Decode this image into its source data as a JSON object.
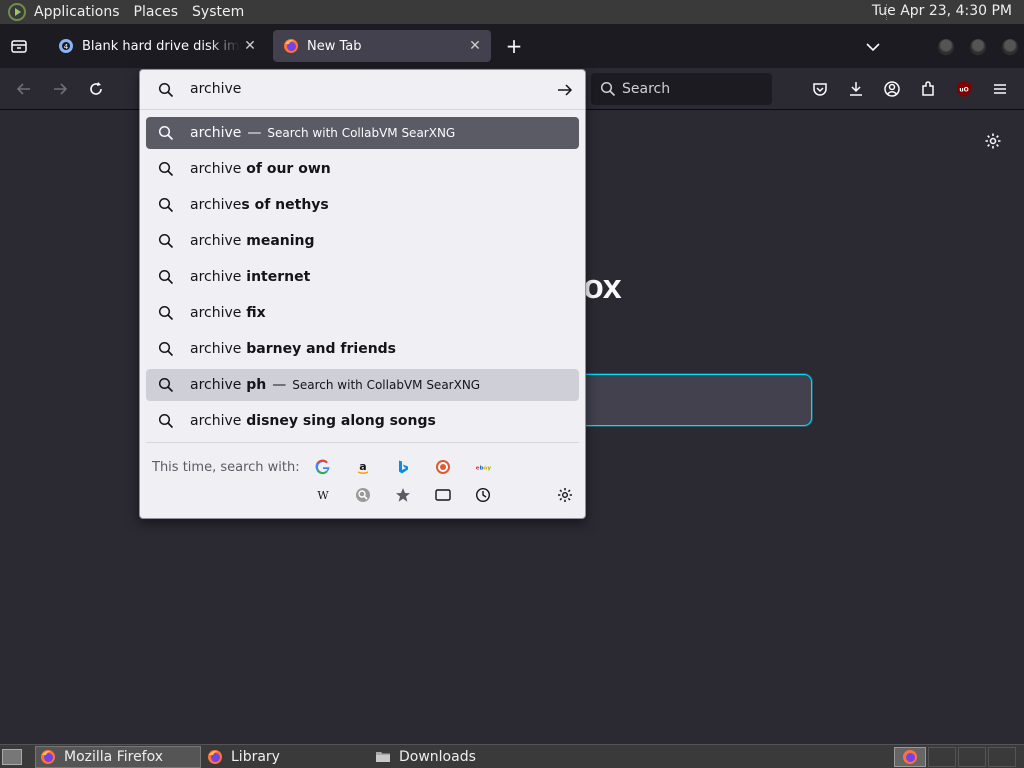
{
  "top_panel": {
    "menus": [
      "Applications",
      "Places",
      "System"
    ],
    "clock": "Tue Apr 23,  4:30 PM"
  },
  "tabs": [
    {
      "title": "Blank hard drive disk images",
      "close": "✕"
    },
    {
      "title": "New Tab",
      "close": "✕"
    }
  ],
  "tabbar": {
    "new_tab": "+"
  },
  "navbar": {
    "search_placeholder": "Search"
  },
  "urlbar": {
    "typed": "archive",
    "results": [
      {
        "prefix": "archive",
        "bold": "",
        "action": "Search with CollabVM SearXNG",
        "state": "selected"
      },
      {
        "prefix": "archive",
        "bold": " of our own",
        "action": "",
        "state": ""
      },
      {
        "prefix": "archive",
        "bold": "s of nethys",
        "action": "",
        "state": ""
      },
      {
        "prefix": "archive",
        "bold": " meaning",
        "action": "",
        "state": ""
      },
      {
        "prefix": "archive",
        "bold": " internet",
        "action": "",
        "state": ""
      },
      {
        "prefix": "archive",
        "bold": " fix",
        "action": "",
        "state": ""
      },
      {
        "prefix": "archive",
        "bold": " barney and friends",
        "action": "",
        "state": ""
      },
      {
        "prefix": "archive",
        "bold": " ph",
        "action": "Search with CollabVM SearXNG",
        "state": "hover"
      },
      {
        "prefix": "archive",
        "bold": " disney sing along songs",
        "action": "",
        "state": ""
      }
    ],
    "dash": "—",
    "oneoff_label": "This time, search with:",
    "engines": [
      "google-icon",
      "amazon-icon",
      "bing-icon",
      "duckduckgo-icon",
      "ebay-icon",
      "wikipedia-icon",
      "searxng-icon",
      "bookmarks-icon",
      "tabs-icon",
      "history-icon",
      "search-settings-icon"
    ]
  },
  "page": {
    "brand_fragment": "ox"
  },
  "taskbar": {
    "items": [
      "Mozilla Firefox",
      "Library",
      "Downloads"
    ]
  },
  "colors": {
    "accent_focus": "#00ddff",
    "selected_row": "#5b5b66",
    "panel_bg": "#f0f0f4"
  }
}
